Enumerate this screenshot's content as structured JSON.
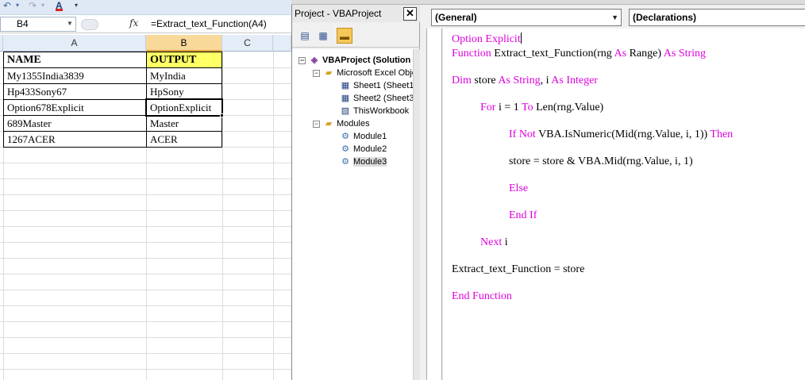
{
  "excel": {
    "qat": {
      "undo_icon": "undo-icon",
      "redo_icon": "redo-icon",
      "font_color_label": "A",
      "customize_icon": "chevron-down-icon"
    },
    "name_box": "B4",
    "fx_label": "fx",
    "formula": "=Extract_text_Function(A4)",
    "columns": [
      "A",
      "B",
      "C"
    ],
    "rows": [
      {
        "a": "NAME",
        "b": "OUTPUT"
      },
      {
        "a": "My1355India3839",
        "b": "MyIndia"
      },
      {
        "a": "Hp433Sony67",
        "b": "HpSony"
      },
      {
        "a": "Option678Explicit",
        "b": "OptionExplicit"
      },
      {
        "a": "689Master",
        "b": "Master"
      },
      {
        "a": "1267ACER",
        "b": "ACER"
      }
    ],
    "colors": {
      "header_highlight": "#ffff66",
      "active_col": "#f9d99a"
    }
  },
  "project_pane": {
    "title": "Project - VBAProject",
    "close_label": "✕",
    "tools": [
      "view-code-icon",
      "view-object-icon",
      "toggle-folders-icon"
    ],
    "tree": [
      {
        "label": "VBAProject (Solution",
        "icon": "project-icon",
        "toggle": "−"
      },
      {
        "label": "Microsoft Excel Obje",
        "icon": "folder-icon",
        "toggle": "−"
      },
      {
        "label": "Sheet1 (Sheet1",
        "icon": "sheet-icon"
      },
      {
        "label": "Sheet2 (Sheet3",
        "icon": "sheet-icon"
      },
      {
        "label": "ThisWorkbook",
        "icon": "workbook-icon"
      },
      {
        "label": "Modules",
        "icon": "folder-icon",
        "toggle": "−"
      },
      {
        "label": "Module1",
        "icon": "module-icon"
      },
      {
        "label": "Module2",
        "icon": "module-icon"
      },
      {
        "label": "Module3",
        "icon": "module-icon"
      }
    ]
  },
  "code_window": {
    "object_combo": "(General)",
    "procedure_combo": "(Declarations)",
    "lines": [
      {
        "kw1": "Option Explicit",
        "text": "",
        "kw2": ""
      },
      {
        "kw1": "Function",
        "text": " Extract_text_Function(rng ",
        "kw2": "As",
        "text2": " Range) ",
        "kw3": "As String"
      },
      {
        "kw1": "Dim",
        "text": " store ",
        "kw2": "As String",
        "text2": ", i ",
        "kw3": "As Integer"
      },
      {
        "kw1": "For",
        "text": " i = 1 ",
        "kw2": "To",
        "text2": " Len(rng.Value)",
        "kw3": ""
      },
      {
        "kw1": "If Not",
        "text": " VBA.IsNumeric(Mid(rng.Value, i, 1)) ",
        "kw2": "Then",
        "text2": "",
        "kw3": ""
      },
      {
        "kw1": "",
        "text": "store = store & VBA.Mid(rng.Value, i, 1)",
        "kw2": "",
        "text2": "",
        "kw3": ""
      },
      {
        "kw1": "Else",
        "text": "",
        "kw2": "",
        "text2": "",
        "kw3": ""
      },
      {
        "kw1": "End If",
        "text": "",
        "kw2": "",
        "text2": "",
        "kw3": ""
      },
      {
        "kw1": "Next",
        "text": " i",
        "kw2": "",
        "text2": "",
        "kw3": ""
      },
      {
        "kw1": "",
        "text": "Extract_text_Function = store",
        "kw2": "",
        "text2": "",
        "kw3": ""
      },
      {
        "kw1": "End Function",
        "text": "",
        "kw2": "",
        "text2": "",
        "kw3": ""
      }
    ],
    "colors": {
      "keyword": "#dd00dd",
      "text": "#000000"
    }
  }
}
